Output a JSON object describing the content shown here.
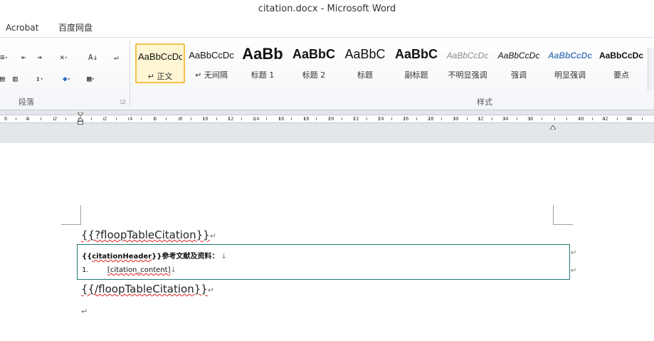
{
  "window": {
    "title": "citation.docx  -  Microsoft Word"
  },
  "menu_tabs": [
    "Acrobat",
    "百度网盘"
  ],
  "ribbon": {
    "paragraph_group_label": "段落",
    "styles_group_label": "样式",
    "styles": [
      {
        "sample": "AaBbCcDc",
        "name": "↵ 正文",
        "selected": true
      },
      {
        "sample": "AaBbCcDc",
        "name": "↵ 无间隔"
      },
      {
        "sample": "AaBb",
        "name": "标题 1"
      },
      {
        "sample": "AaBbC",
        "name": "标题 2"
      },
      {
        "sample": "AaBbC",
        "name": "标题"
      },
      {
        "sample": "AaBbC",
        "name": "副标题"
      },
      {
        "sample": "AaBbCcDc",
        "name": "不明显强调"
      },
      {
        "sample": "AaBbCcDc",
        "name": "强调"
      },
      {
        "sample": "AaBbCcDc",
        "name": "明显强调"
      },
      {
        "sample": "AaBbCcDc",
        "name": "要点"
      }
    ]
  },
  "ruler": {
    "labels": [
      "6",
      "4",
      "2",
      "2",
      "4",
      "6",
      "8",
      "10",
      "12",
      "14",
      "16",
      "18",
      "20",
      "22",
      "24",
      "26",
      "28",
      "30",
      "32",
      "34",
      "36",
      "40",
      "42",
      "44"
    ]
  },
  "document": {
    "line_open": "{{?floopTableCitation}}",
    "table_header_prefix": "{{",
    "table_header_key": "citationHeader",
    "table_header_suffix": "}}参考文献及资料：",
    "list_number": "1.",
    "citation_content": "[citation_content]",
    "line_close": "{{/floopTableCitation}}",
    "paragraph_mark": "↵"
  }
}
